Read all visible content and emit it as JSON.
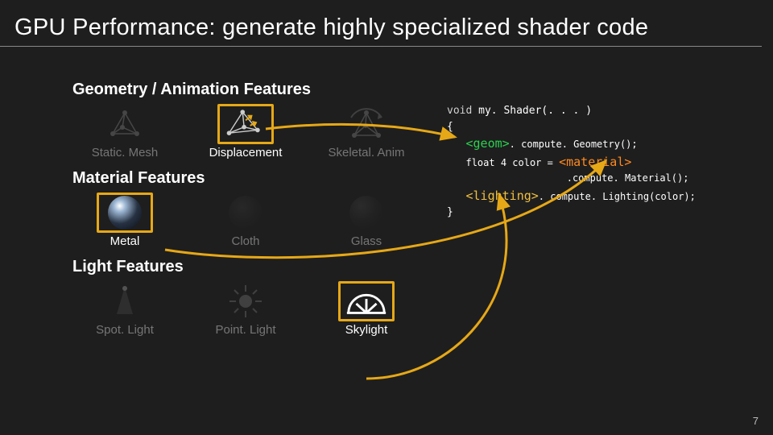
{
  "title": "GPU Performance: generate highly specialized shader code",
  "sections": {
    "geometry": {
      "heading": "Geometry / Animation Features",
      "items": [
        "Static. Mesh",
        "Displacement",
        "Skeletal. Anim"
      ]
    },
    "material": {
      "heading": "Material Features",
      "items": [
        "Metal",
        "Cloth",
        "Glass"
      ]
    },
    "light": {
      "heading": "Light Features",
      "items": [
        "Spot. Light",
        "Point. Light",
        "Skylight"
      ]
    }
  },
  "code": {
    "l1a": "void",
    "l1b": " my. Shader(. . . )",
    "l2": "{",
    "l3a": "<geom>",
    "l3b": ". compute. Geometry();",
    "l4a": "float 4 ",
    "l4b": "color = ",
    "l4c": "<material>",
    "l5": ".compute. Material();",
    "l6a": "<lighting>",
    "l6b": ". compute. Lighting(color);",
    "l7": "}"
  },
  "pagenum": "7",
  "colors": {
    "highlight": "#e6a817",
    "geom": "#2bd14f",
    "material": "#ff8a1f",
    "lighting": "#f0c040"
  }
}
